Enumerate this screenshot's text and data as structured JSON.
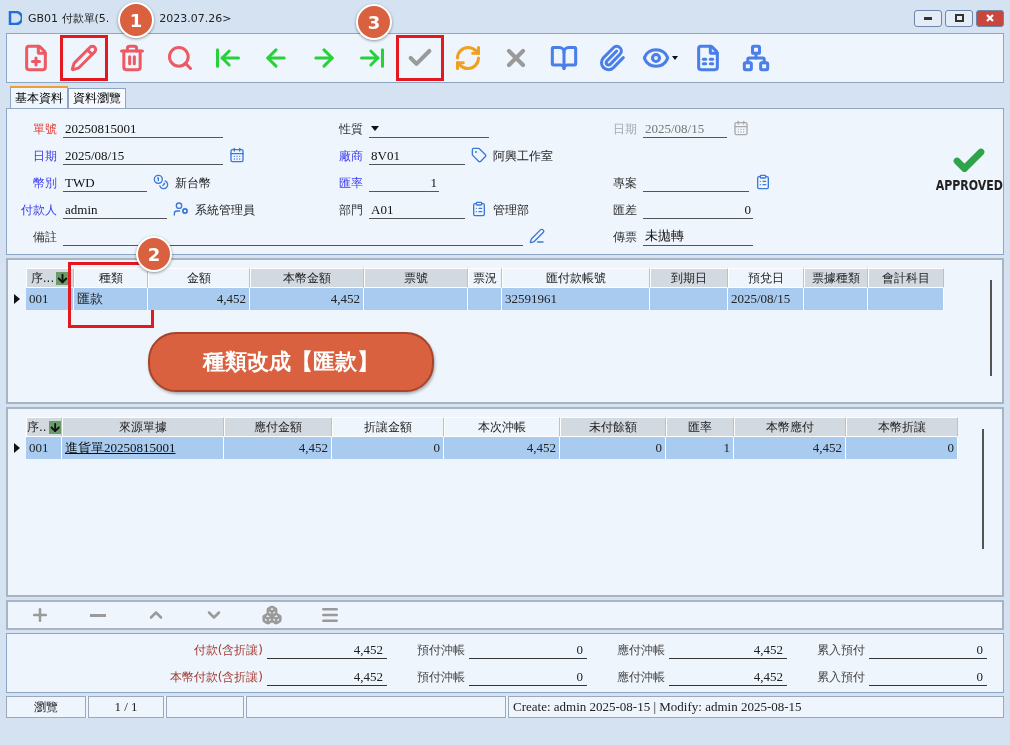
{
  "window": {
    "title": "GB01 付款單(5.",
    "version": "2023.07.26>"
  },
  "toolbar": [
    {
      "kind": "new",
      "disabled": false,
      "highlighted": false
    },
    {
      "kind": "edit",
      "disabled": false,
      "highlighted": true
    },
    {
      "kind": "delete",
      "disabled": false,
      "highlighted": false
    },
    {
      "kind": "find",
      "disabled": false,
      "highlighted": false
    },
    {
      "kind": "first",
      "disabled": false,
      "highlighted": false
    },
    {
      "kind": "prev",
      "disabled": false,
      "highlighted": false
    },
    {
      "kind": "next",
      "disabled": false,
      "highlighted": false
    },
    {
      "kind": "last",
      "disabled": false,
      "highlighted": false
    },
    {
      "kind": "confirm",
      "disabled": true,
      "highlighted": true
    },
    {
      "kind": "refresh",
      "disabled": false,
      "highlighted": false
    },
    {
      "kind": "cancel",
      "disabled": true,
      "highlighted": false
    },
    {
      "kind": "book",
      "disabled": false,
      "highlighted": false
    },
    {
      "kind": "attach",
      "disabled": false,
      "highlighted": false
    },
    {
      "kind": "view",
      "disabled": false,
      "highlighted": false
    },
    {
      "kind": "export",
      "disabled": false,
      "highlighted": false
    },
    {
      "kind": "flow",
      "disabled": false,
      "highlighted": false
    }
  ],
  "tabs": [
    {
      "label": "基本資料",
      "selected": true
    },
    {
      "label": "資料瀏覽",
      "selected": false
    }
  ],
  "form": {
    "rows": [
      [
        {
          "label": "單號",
          "required": true,
          "link": false,
          "disabled": false,
          "kind": "text",
          "value": "20250815001"
        },
        {
          "label": "性質",
          "required": false,
          "link": false,
          "disabled": false,
          "kind": "select"
        },
        {
          "label": "日期",
          "required": false,
          "link": false,
          "disabled": true,
          "kind": "date",
          "value": "2025/08/15"
        }
      ],
      [
        {
          "label": "日期",
          "required": false,
          "link": true,
          "disabled": false,
          "kind": "date",
          "value": "2025/08/15"
        },
        {
          "label": "廠商",
          "required": false,
          "link": true,
          "disabled": false,
          "kind": "vendor",
          "value": "8V01",
          "desc": "阿興工作室"
        }
      ],
      [
        {
          "label": "幣別",
          "required": false,
          "link": true,
          "disabled": false,
          "kind": "currency",
          "value": "TWD",
          "desc": "新台幣"
        },
        {
          "label": "匯率",
          "required": false,
          "link": true,
          "disabled": false,
          "kind": "number",
          "value": "1"
        },
        {
          "label": "專案",
          "required": false,
          "link": false,
          "disabled": false,
          "kind": "list"
        }
      ],
      [
        {
          "label": "付款人",
          "required": false,
          "link": true,
          "disabled": false,
          "kind": "user",
          "value": "admin",
          "desc": "系統管理員"
        },
        {
          "label": "部門",
          "required": false,
          "link": false,
          "disabled": false,
          "kind": "list",
          "value": "A01",
          "desc": "管理部"
        },
        {
          "label": "匯差",
          "required": false,
          "link": false,
          "disabled": false,
          "kind": "number",
          "value": "0"
        }
      ],
      [
        {
          "label": "備註",
          "required": false,
          "link": false,
          "disabled": false,
          "kind": "note"
        },
        "",
        {
          "label": "傳票",
          "required": false,
          "link": false,
          "disabled": false,
          "kind": "text",
          "value": "未拋轉"
        }
      ]
    ],
    "status_stamp": "APPROVED"
  },
  "payment_grid": {
    "columns": [
      {
        "label": "序...",
        "shaded": true,
        "sorted": true,
        "highlighted": false
      },
      {
        "label": "種類",
        "shaded": false,
        "numeric": false,
        "sorted": false,
        "highlighted": true
      },
      {
        "label": "金額",
        "shaded": false,
        "numeric": true,
        "sorted": false,
        "highlighted": false
      },
      {
        "label": "本幣金額",
        "shaded": true,
        "numeric": true,
        "sorted": false,
        "highlighted": false
      },
      {
        "label": "票號",
        "shaded": true,
        "sorted": false,
        "highlighted": false
      },
      {
        "label": "票況",
        "shaded": false,
        "sorted": false,
        "highlighted": false
      },
      {
        "label": "匯付款帳號",
        "shaded": false,
        "numeric": false,
        "sorted": false,
        "highlighted": false
      },
      {
        "label": "到期日",
        "shaded": true,
        "sorted": false,
        "highlighted": false
      },
      {
        "label": "預兌日",
        "shaded": false,
        "numeric": false,
        "sorted": false,
        "highlighted": false
      },
      {
        "label": "票據種類",
        "shaded": true,
        "sorted": false,
        "highlighted": false
      },
      {
        "label": "會計科目",
        "shaded": true,
        "sorted": false,
        "highlighted": false
      }
    ],
    "rows": [
      {
        "selected": true,
        "cells": [
          "001",
          "匯款",
          "4,452",
          "4,452",
          "",
          "",
          "32591961",
          "",
          "2025/08/15",
          "",
          ""
        ]
      }
    ]
  },
  "source_grid": {
    "columns": [
      {
        "label": "序..",
        "shaded": true,
        "sorted": true,
        "highlighted": false
      },
      {
        "label": "來源單據",
        "shaded": true,
        "numeric": false,
        "sorted": false,
        "highlighted": false
      },
      {
        "label": "應付金額",
        "shaded": true,
        "numeric": true,
        "sorted": false,
        "highlighted": false
      },
      {
        "label": "折讓金額",
        "shaded": false,
        "numeric": true,
        "sorted": false,
        "highlighted": false
      },
      {
        "label": "本次沖帳",
        "shaded": false,
        "numeric": true,
        "sorted": false,
        "highlighted": false
      },
      {
        "label": "未付餘額",
        "shaded": true,
        "numeric": true,
        "sorted": false,
        "highlighted": false
      },
      {
        "label": "匯率",
        "shaded": true,
        "numeric": true,
        "sorted": false,
        "highlighted": false
      },
      {
        "label": "本幣應付",
        "shaded": true,
        "numeric": true,
        "sorted": false,
        "highlighted": false
      },
      {
        "label": "本幣折讓",
        "shaded": true,
        "numeric": true,
        "sorted": false,
        "highlighted": false
      }
    ],
    "rows": [
      {
        "selected": true,
        "cells": [
          "001",
          "進貨單20250815001",
          "4,452",
          "0",
          "4,452",
          "0",
          "1",
          "4,452",
          "0"
        ]
      }
    ]
  },
  "detail_toolbar": [
    {
      "kind": "add",
      "disabled": true
    },
    {
      "kind": "remove",
      "disabled": true
    },
    {
      "kind": "up",
      "disabled": true
    },
    {
      "kind": "down",
      "disabled": true
    },
    {
      "kind": "group",
      "disabled": true
    },
    {
      "kind": "menu",
      "disabled": true
    }
  ],
  "totals": [
    [
      {
        "label": "付款(含折讓)",
        "value": "4,452"
      },
      {
        "label": "預付沖帳",
        "value": "0"
      },
      {
        "label": "應付沖帳",
        "value": "4,452"
      },
      {
        "label": "累入預付",
        "value": "0"
      }
    ],
    [
      {
        "label": "本幣付款(含折讓)",
        "value": "4,452"
      },
      {
        "label": "預付沖帳",
        "value": "0"
      },
      {
        "label": "應付沖帳",
        "value": "4,452"
      },
      {
        "label": "累入預付",
        "value": "0"
      }
    ]
  ],
  "status_bar": {
    "mode": "瀏覽",
    "position": "1 / 1",
    "audit": "Create: admin 2025-08-15 | Modify: admin 2025-08-15"
  },
  "annotations": {
    "badges": [
      "1",
      "2",
      "3"
    ],
    "callout": "種類改成【匯款】"
  }
}
